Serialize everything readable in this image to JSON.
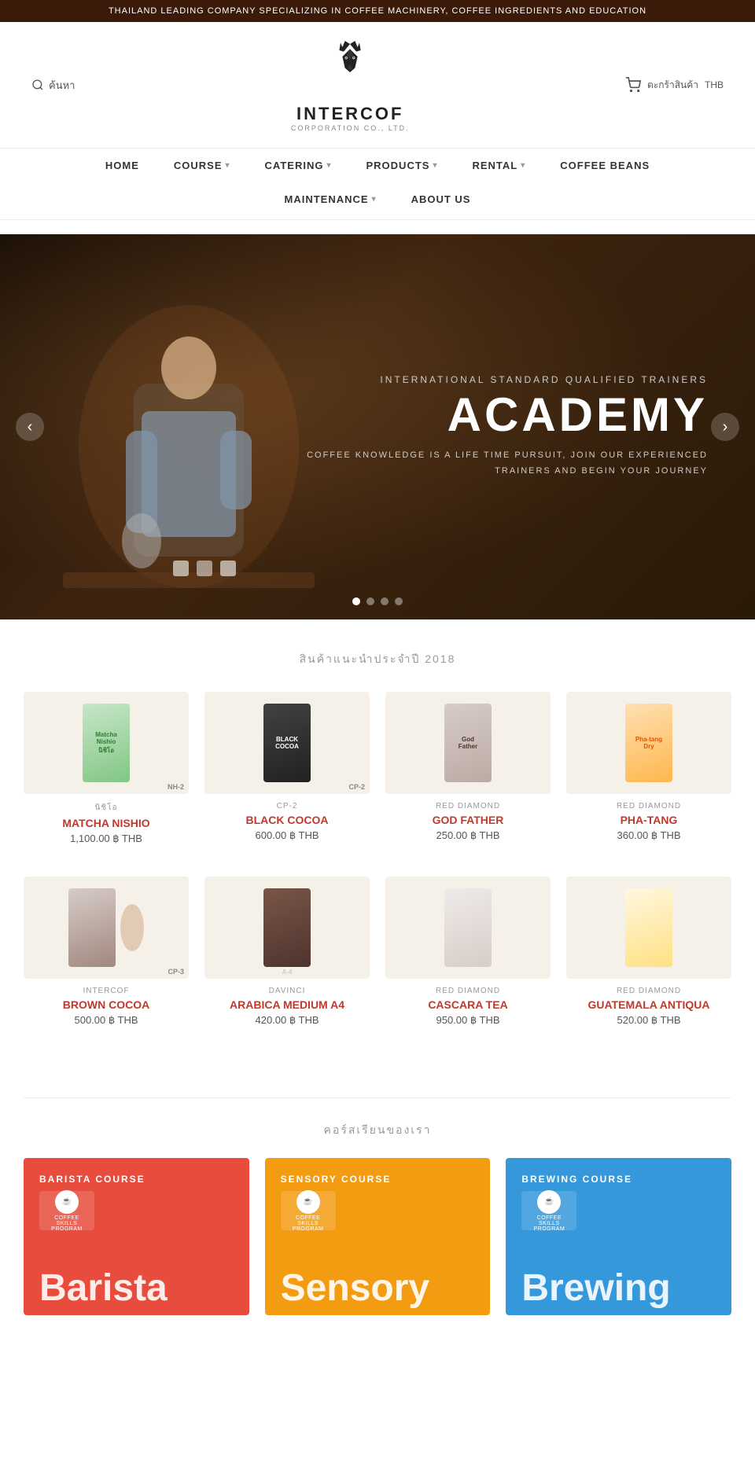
{
  "topbar": {
    "text": "THAILAND LEADING COMPANY SPECIALIZING IN COFFEE MACHINERY, COFFEE INGREDIENTS AND EDUCATION"
  },
  "header": {
    "search_placeholder": "ค้นหา",
    "search_label": "ค้นหา",
    "logo_title": "INTERCOF",
    "logo_subtitle": "CORPORATION CO., LTD.",
    "cart_label": "ตะกร้าสินค้า",
    "currency": "THB"
  },
  "nav": {
    "row1": [
      {
        "label": "HOME",
        "has_dropdown": false
      },
      {
        "label": "COURSE",
        "has_dropdown": true
      },
      {
        "label": "CATERING",
        "has_dropdown": true
      },
      {
        "label": "PRODUCTS",
        "has_dropdown": true
      },
      {
        "label": "RENTAL",
        "has_dropdown": true
      },
      {
        "label": "COFFEE BEANS",
        "has_dropdown": false
      }
    ],
    "row2": [
      {
        "label": "MAINTENANCE",
        "has_dropdown": true
      },
      {
        "label": "ABOUT US",
        "has_dropdown": false
      }
    ]
  },
  "slider": {
    "subtitle": "INTERNATIONAL STANDARD QUALIFIED TRAINERS",
    "title": "ACADEMY",
    "description": "COFFEE KNOWLEDGE IS A LIFE TIME PURSUIT, JOIN OUR EXPERIENCED\nTRAINERS AND BEGIN YOUR JOURNEY",
    "dots": [
      {
        "active": true
      },
      {
        "active": false
      },
      {
        "active": false
      },
      {
        "active": false
      }
    ],
    "prev_label": "‹",
    "next_label": "›"
  },
  "featured_section": {
    "title": "สินค้าแนะนำประจำปี 2018",
    "products": [
      {
        "brand": "นิชิโอ",
        "code": "NH-2",
        "name": "MATCHA NISHIO",
        "price": "1,100.00 ฿ THB",
        "pkg_type": "green"
      },
      {
        "brand": "CP-2",
        "code": "CP-2",
        "name": "BLACK COCOA",
        "price": "600.00 ฿ THB",
        "pkg_type": "black"
      },
      {
        "brand": "RED DIAMOND",
        "code": "",
        "name": "GOD FATHER",
        "price": "250.00 ฿ THB",
        "pkg_type": "kraft"
      },
      {
        "brand": "RED DIAMOND",
        "code": "",
        "name": "PHA-TANG",
        "price": "360.00 ฿ THB",
        "pkg_type": "kraft2"
      },
      {
        "brand": "INTERCOF",
        "code": "CP-3",
        "name": "BROWN COCOA",
        "price": "500.00 ฿ THB",
        "pkg_type": "brown"
      },
      {
        "brand": "DAVINCI",
        "code": "A-4",
        "name": "ARABICA MEDIUM A4",
        "price": "420.00 ฿ THB",
        "pkg_type": "dark"
      },
      {
        "brand": "RED DIAMOND",
        "code": "",
        "name": "CASCARA TEA",
        "price": "950.00 ฿ THB",
        "pkg_type": "tan"
      },
      {
        "brand": "RED DIAMOND",
        "code": "",
        "name": "GUATEMALA ANTIQUA",
        "price": "520.00 ฿ THB",
        "pkg_type": "cream"
      }
    ]
  },
  "courses_section": {
    "title": "คอร์สเรียนของเรา",
    "courses": [
      {
        "id": "barista",
        "label": "BARISTA COURSE",
        "title": "Barista",
        "color_class": "barista"
      },
      {
        "id": "sensory",
        "label": "SENSORY COURSE",
        "title": "Sensory",
        "color_class": "sensory"
      },
      {
        "id": "brewing",
        "label": "BREWING COURSE",
        "title": "Brewing",
        "color_class": "brewing"
      }
    ]
  }
}
